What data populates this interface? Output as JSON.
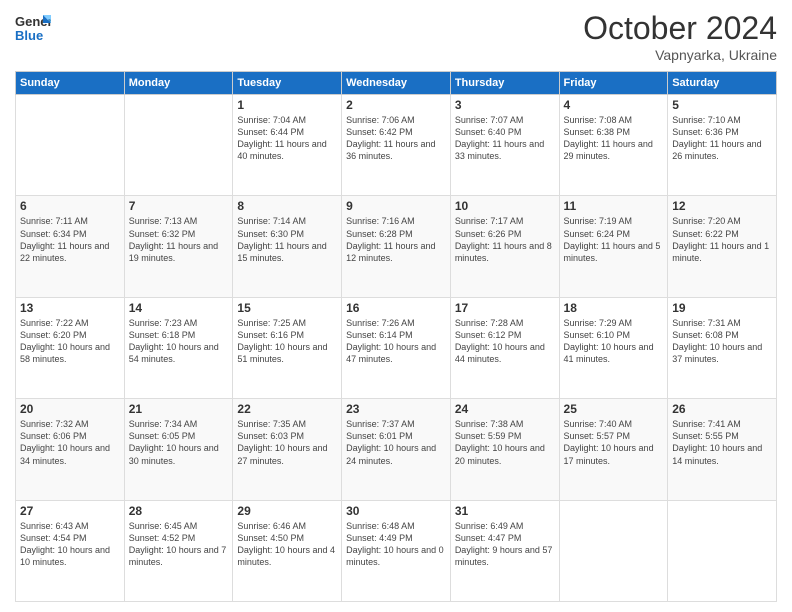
{
  "header": {
    "logo_general": "General",
    "logo_blue": "Blue",
    "month_title": "October 2024",
    "subtitle": "Vapnyarka, Ukraine"
  },
  "days_of_week": [
    "Sunday",
    "Monday",
    "Tuesday",
    "Wednesday",
    "Thursday",
    "Friday",
    "Saturday"
  ],
  "weeks": [
    [
      {
        "day": "",
        "info": ""
      },
      {
        "day": "",
        "info": ""
      },
      {
        "day": "1",
        "info": "Sunrise: 7:04 AM\nSunset: 6:44 PM\nDaylight: 11 hours and 40 minutes."
      },
      {
        "day": "2",
        "info": "Sunrise: 7:06 AM\nSunset: 6:42 PM\nDaylight: 11 hours and 36 minutes."
      },
      {
        "day": "3",
        "info": "Sunrise: 7:07 AM\nSunset: 6:40 PM\nDaylight: 11 hours and 33 minutes."
      },
      {
        "day": "4",
        "info": "Sunrise: 7:08 AM\nSunset: 6:38 PM\nDaylight: 11 hours and 29 minutes."
      },
      {
        "day": "5",
        "info": "Sunrise: 7:10 AM\nSunset: 6:36 PM\nDaylight: 11 hours and 26 minutes."
      }
    ],
    [
      {
        "day": "6",
        "info": "Sunrise: 7:11 AM\nSunset: 6:34 PM\nDaylight: 11 hours and 22 minutes."
      },
      {
        "day": "7",
        "info": "Sunrise: 7:13 AM\nSunset: 6:32 PM\nDaylight: 11 hours and 19 minutes."
      },
      {
        "day": "8",
        "info": "Sunrise: 7:14 AM\nSunset: 6:30 PM\nDaylight: 11 hours and 15 minutes."
      },
      {
        "day": "9",
        "info": "Sunrise: 7:16 AM\nSunset: 6:28 PM\nDaylight: 11 hours and 12 minutes."
      },
      {
        "day": "10",
        "info": "Sunrise: 7:17 AM\nSunset: 6:26 PM\nDaylight: 11 hours and 8 minutes."
      },
      {
        "day": "11",
        "info": "Sunrise: 7:19 AM\nSunset: 6:24 PM\nDaylight: 11 hours and 5 minutes."
      },
      {
        "day": "12",
        "info": "Sunrise: 7:20 AM\nSunset: 6:22 PM\nDaylight: 11 hours and 1 minute."
      }
    ],
    [
      {
        "day": "13",
        "info": "Sunrise: 7:22 AM\nSunset: 6:20 PM\nDaylight: 10 hours and 58 minutes."
      },
      {
        "day": "14",
        "info": "Sunrise: 7:23 AM\nSunset: 6:18 PM\nDaylight: 10 hours and 54 minutes."
      },
      {
        "day": "15",
        "info": "Sunrise: 7:25 AM\nSunset: 6:16 PM\nDaylight: 10 hours and 51 minutes."
      },
      {
        "day": "16",
        "info": "Sunrise: 7:26 AM\nSunset: 6:14 PM\nDaylight: 10 hours and 47 minutes."
      },
      {
        "day": "17",
        "info": "Sunrise: 7:28 AM\nSunset: 6:12 PM\nDaylight: 10 hours and 44 minutes."
      },
      {
        "day": "18",
        "info": "Sunrise: 7:29 AM\nSunset: 6:10 PM\nDaylight: 10 hours and 41 minutes."
      },
      {
        "day": "19",
        "info": "Sunrise: 7:31 AM\nSunset: 6:08 PM\nDaylight: 10 hours and 37 minutes."
      }
    ],
    [
      {
        "day": "20",
        "info": "Sunrise: 7:32 AM\nSunset: 6:06 PM\nDaylight: 10 hours and 34 minutes."
      },
      {
        "day": "21",
        "info": "Sunrise: 7:34 AM\nSunset: 6:05 PM\nDaylight: 10 hours and 30 minutes."
      },
      {
        "day": "22",
        "info": "Sunrise: 7:35 AM\nSunset: 6:03 PM\nDaylight: 10 hours and 27 minutes."
      },
      {
        "day": "23",
        "info": "Sunrise: 7:37 AM\nSunset: 6:01 PM\nDaylight: 10 hours and 24 minutes."
      },
      {
        "day": "24",
        "info": "Sunrise: 7:38 AM\nSunset: 5:59 PM\nDaylight: 10 hours and 20 minutes."
      },
      {
        "day": "25",
        "info": "Sunrise: 7:40 AM\nSunset: 5:57 PM\nDaylight: 10 hours and 17 minutes."
      },
      {
        "day": "26",
        "info": "Sunrise: 7:41 AM\nSunset: 5:55 PM\nDaylight: 10 hours and 14 minutes."
      }
    ],
    [
      {
        "day": "27",
        "info": "Sunrise: 6:43 AM\nSunset: 4:54 PM\nDaylight: 10 hours and 10 minutes."
      },
      {
        "day": "28",
        "info": "Sunrise: 6:45 AM\nSunset: 4:52 PM\nDaylight: 10 hours and 7 minutes."
      },
      {
        "day": "29",
        "info": "Sunrise: 6:46 AM\nSunset: 4:50 PM\nDaylight: 10 hours and 4 minutes."
      },
      {
        "day": "30",
        "info": "Sunrise: 6:48 AM\nSunset: 4:49 PM\nDaylight: 10 hours and 0 minutes."
      },
      {
        "day": "31",
        "info": "Sunrise: 6:49 AM\nSunset: 4:47 PM\nDaylight: 9 hours and 57 minutes."
      },
      {
        "day": "",
        "info": ""
      },
      {
        "day": "",
        "info": ""
      }
    ]
  ]
}
